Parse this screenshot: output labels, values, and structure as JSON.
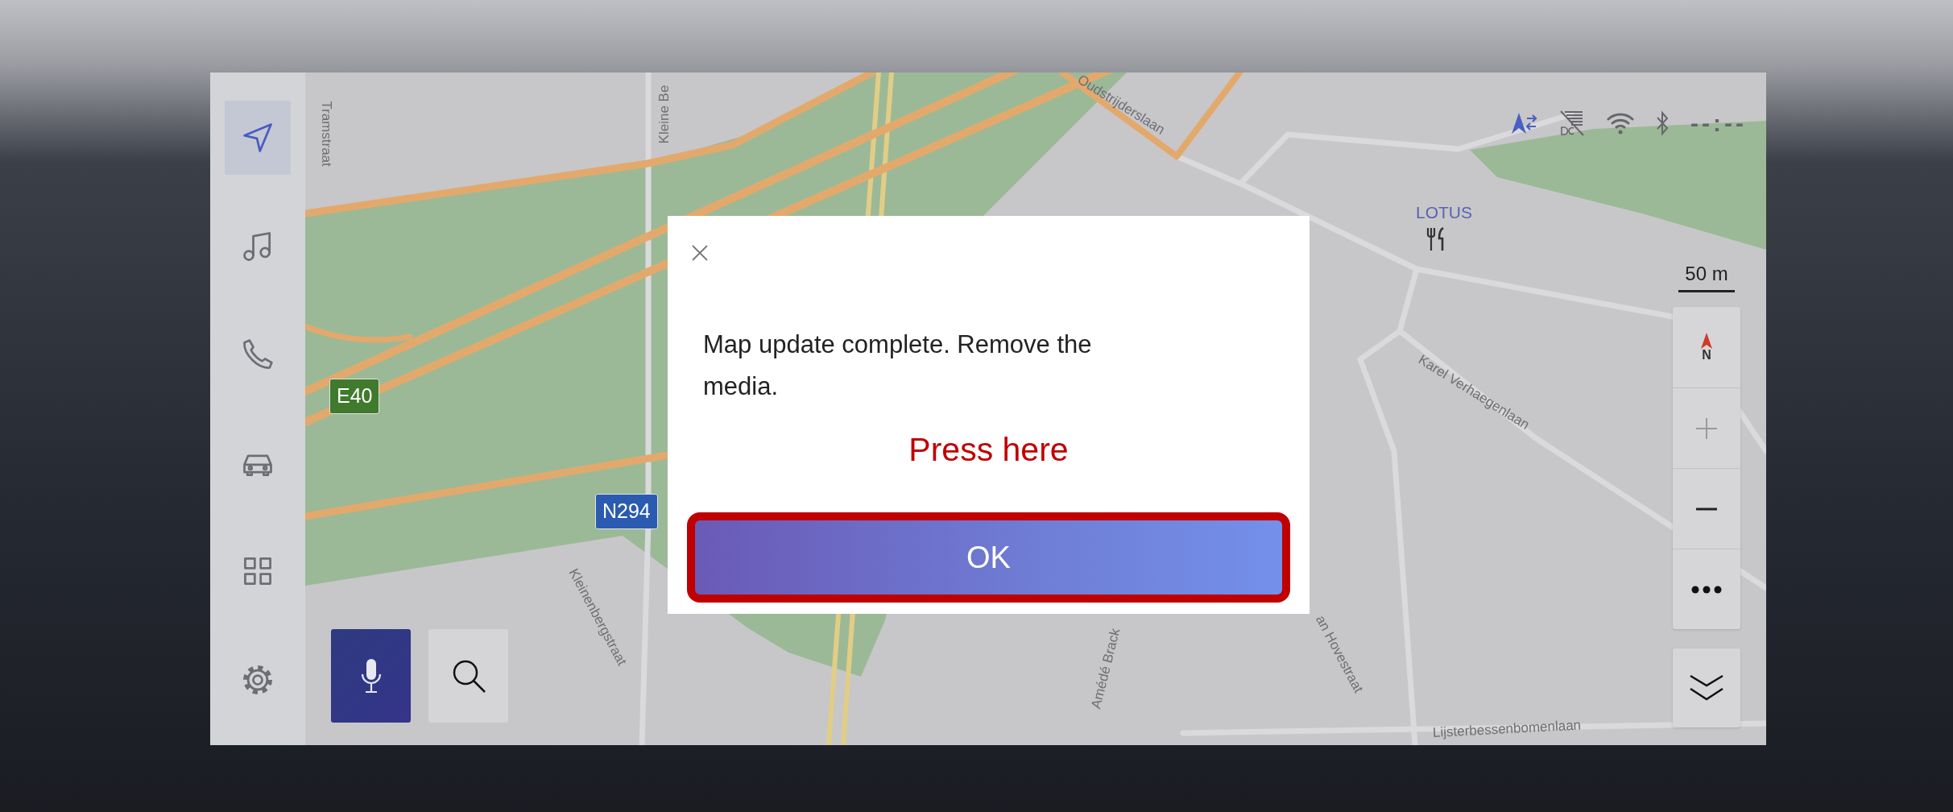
{
  "sidebar": {
    "items": [
      {
        "kind": "navigation",
        "selected": true
      },
      {
        "kind": "music",
        "selected": false
      },
      {
        "kind": "phone",
        "selected": false
      },
      {
        "kind": "car",
        "selected": false
      },
      {
        "kind": "apps",
        "selected": false
      },
      {
        "kind": "settings",
        "selected": false
      }
    ]
  },
  "status_bar": {
    "time": "--:--"
  },
  "map": {
    "street_labels": [
      "Tramstraat",
      "Kleine Be",
      "Oudstrijderslaan",
      "Karel Verhaegenlaan",
      "Kleinenbergstraat",
      "Amédé Brack",
      "an Hovestraat",
      "Lijsterbessenbomenlaan"
    ],
    "road_shields": [
      {
        "kind": "motorway",
        "text": "E40"
      },
      {
        "kind": "national",
        "text": "N294"
      }
    ],
    "poi": {
      "name": "LOTUS"
    }
  },
  "map_controls": {
    "scale": "50 m",
    "compass": "N"
  },
  "dialog": {
    "message": "Map update complete. Remove the media.",
    "hint": "Press here",
    "button": {
      "label": "OK",
      "highlighted": true
    }
  }
}
